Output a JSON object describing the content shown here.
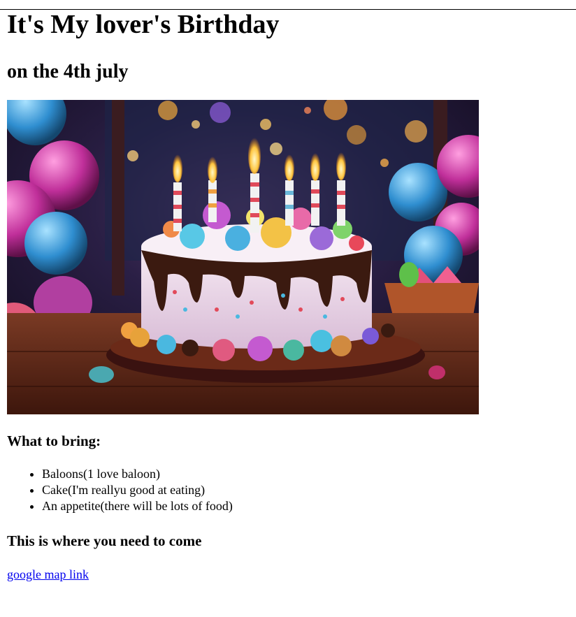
{
  "page": {
    "title": "It's My lover's Birthday",
    "subtitle": "on the 4th july"
  },
  "image": {
    "subject": "birthday-cake-with-candles"
  },
  "bring": {
    "heading": "What to bring:",
    "items": [
      "Baloons(1 love baloon)",
      "Cake(I'm reallyu good at eating)",
      "An appetite(there will be lots of food)"
    ]
  },
  "location": {
    "heading": "This is where you need to come",
    "link_text": "google map link"
  },
  "colors": {
    "link": "#0000ee",
    "text": "#000000",
    "background": "#ffffff"
  }
}
